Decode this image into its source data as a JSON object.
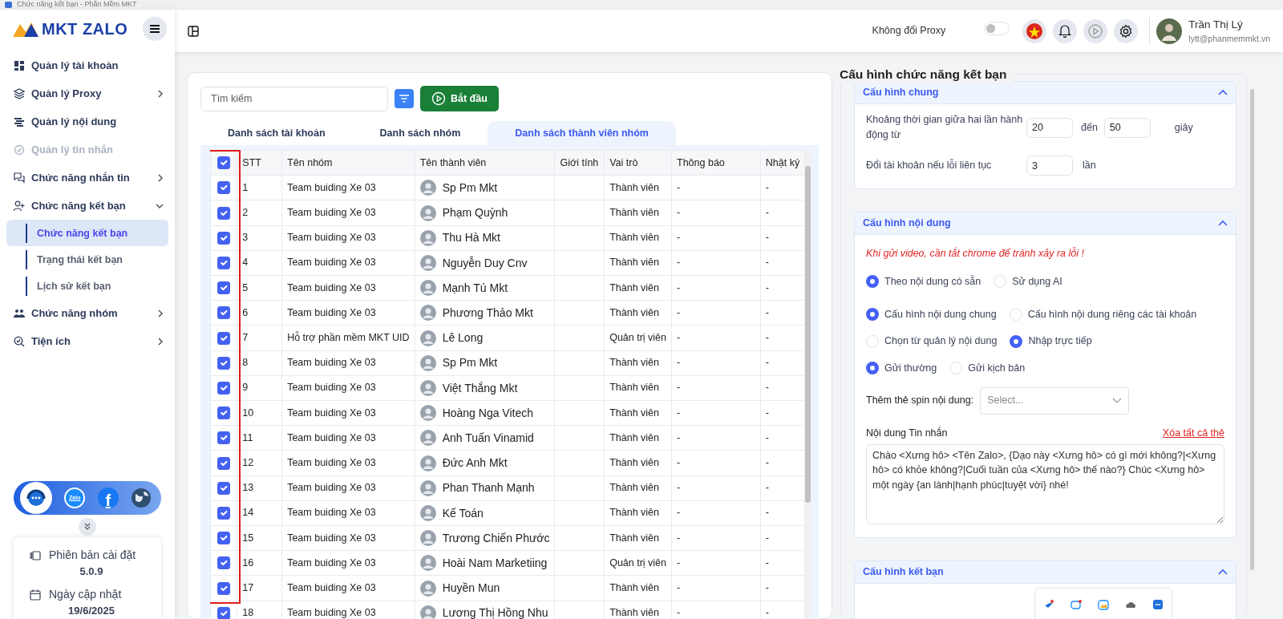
{
  "window": {
    "title": "Chức năng kết bạn - Phần Mềm MKT"
  },
  "sidebar": {
    "logo": "MKT ZALO",
    "items": [
      {
        "label": "Quản lý tài khoản",
        "chevron": false,
        "expanded": false,
        "disabled": false
      },
      {
        "label": "Quản lý Proxy",
        "chevron": true,
        "expanded": false,
        "disabled": false
      },
      {
        "label": "Quản lý nội dung",
        "chevron": false,
        "expanded": false,
        "disabled": false
      },
      {
        "label": "Quản lý tin nhắn",
        "chevron": false,
        "expanded": false,
        "disabled": true
      },
      {
        "label": "Chức năng nhắn tin",
        "chevron": true,
        "expanded": false,
        "disabled": false
      },
      {
        "label": "Chức năng kết bạn",
        "chevron": true,
        "expanded": true,
        "disabled": false,
        "children": [
          {
            "label": "Chức năng kết bạn",
            "selected": true
          },
          {
            "label": "Trạng thái kết bạn",
            "selected": false
          },
          {
            "label": "Lịch sử kết bạn",
            "selected": false
          }
        ]
      },
      {
        "label": "Chức năng nhóm",
        "chevron": true,
        "expanded": false,
        "disabled": false
      },
      {
        "label": "Tiện ích",
        "chevron": true,
        "expanded": false,
        "disabled": false
      }
    ],
    "social_links": [
      {
        "label": "Zalo"
      },
      {
        "label": "f"
      }
    ],
    "version": {
      "label": "Phiên bản cài đặt",
      "value": "5.0.9"
    },
    "updated": {
      "label": "Ngày cập nhật",
      "value": "19/6/2025"
    }
  },
  "topbar": {
    "proxy_label": "Không đổi Proxy",
    "proxy_on": false,
    "user": {
      "name": "Trần Thị Lý",
      "email": "lytt@phanmemmkt.vn"
    }
  },
  "toolbar": {
    "search": {
      "placeholder": "Tìm kiếm"
    },
    "start_button": "Bắt đầu"
  },
  "tabs": [
    {
      "label": "Danh sách tài khoản",
      "selected": false
    },
    {
      "label": "Danh sách nhóm",
      "selected": false
    },
    {
      "label": "Danh sách thành viên nhóm",
      "selected": true
    }
  ],
  "table": {
    "all_checked": true,
    "columns": [
      "STT",
      "Tên nhóm",
      "Tên thành viên",
      "Giới tính",
      "Vai trò",
      "Thông báo",
      "Nhật ký"
    ],
    "rows": [
      {
        "checked": true,
        "stt": "1",
        "group": "Team buiding Xe 03",
        "member": "Sp Pm Mkt",
        "role": "Thành viên",
        "notice": "-",
        "log": "-"
      },
      {
        "checked": true,
        "stt": "2",
        "group": "Team buiding Xe 03",
        "member": "Phạm Quỳnh",
        "role": "Thành viên",
        "notice": "-",
        "log": "-"
      },
      {
        "checked": true,
        "stt": "3",
        "group": "Team buiding Xe 03",
        "member": "Thu Hà Mkt",
        "role": "Thành viên",
        "notice": "-",
        "log": "-"
      },
      {
        "checked": true,
        "stt": "4",
        "group": "Team buiding Xe 03",
        "member": "Nguyễn Duy Cnv",
        "role": "Thành viên",
        "notice": "-",
        "log": "-"
      },
      {
        "checked": true,
        "stt": "5",
        "group": "Team buiding Xe 03",
        "member": "Mạnh Tú Mkt",
        "role": "Thành viên",
        "notice": "-",
        "log": "-"
      },
      {
        "checked": true,
        "stt": "6",
        "group": "Team buiding Xe 03",
        "member": "Phương Thảo Mkt",
        "role": "Thành viên",
        "notice": "-",
        "log": "-"
      },
      {
        "checked": true,
        "stt": "7",
        "group": "Hỗ trợ phần mềm MKT UID",
        "member": "Lê Long",
        "role": "Quản trị viên",
        "notice": "-",
        "log": "-"
      },
      {
        "checked": true,
        "stt": "8",
        "group": "Team buiding Xe 03",
        "member": "Sp Pm Mkt",
        "role": "Thành viên",
        "notice": "-",
        "log": "-"
      },
      {
        "checked": true,
        "stt": "9",
        "group": "Team buiding Xe 03",
        "member": "Việt Thắng Mkt",
        "role": "Thành viên",
        "notice": "-",
        "log": "-"
      },
      {
        "checked": true,
        "stt": "10",
        "group": "Team buiding Xe 03",
        "member": "Hoàng Nga Vitech",
        "role": "Thành viên",
        "notice": "-",
        "log": "-"
      },
      {
        "checked": true,
        "stt": "11",
        "group": "Team buiding Xe 03",
        "member": "Anh Tuấn Vinamid",
        "role": "Thành viên",
        "notice": "-",
        "log": "-"
      },
      {
        "checked": true,
        "stt": "12",
        "group": "Team buiding Xe 03",
        "member": "Đức Anh Mkt",
        "role": "Thành viên",
        "notice": "-",
        "log": "-"
      },
      {
        "checked": true,
        "stt": "13",
        "group": "Team buiding Xe 03",
        "member": "Phan Thanh Mạnh",
        "role": "Thành viên",
        "notice": "-",
        "log": "-"
      },
      {
        "checked": true,
        "stt": "14",
        "group": "Team buiding Xe 03",
        "member": "Kế Toán",
        "role": "Thành viên",
        "notice": "-",
        "log": "-"
      },
      {
        "checked": true,
        "stt": "15",
        "group": "Team buiding Xe 03",
        "member": "Trương Chiến Phước",
        "role": "Thành viên",
        "notice": "-",
        "log": "-"
      },
      {
        "checked": true,
        "stt": "16",
        "group": "Team buiding Xe 03",
        "member": "Hoài Nam Marketiing",
        "role": "Quản trị viên",
        "notice": "-",
        "log": "-"
      },
      {
        "checked": true,
        "stt": "17",
        "group": "Team buiding Xe 03",
        "member": "Huyền Mun",
        "role": "Thành viên",
        "notice": "-",
        "log": "-"
      },
      {
        "checked": true,
        "stt": "18",
        "group": "Team buiding Xe 03",
        "member": "Lương Thị Hồng Nhu",
        "role": "Thành viên",
        "notice": "-",
        "log": "-"
      }
    ]
  },
  "config": {
    "title": "Cấu hình chức năng kết bạn",
    "sections": [
      {
        "kind": "general",
        "title": "Cấu hình chung",
        "expanded": true,
        "rows": [
          {
            "label": "Khoảng thời gian giữa hai lần hành động từ",
            "values": [
              "20",
              "50"
            ],
            "between": "đến",
            "unit": "giây"
          },
          {
            "label": "Đổi tài khoản nếu lỗi liên tục",
            "values": [
              "3"
            ],
            "unit": "lần"
          }
        ]
      },
      {
        "kind": "content",
        "title": "Cấu hình nội dung",
        "expanded": true,
        "warning": "Khi gửi video, cần tắt chrome để tránh xảy ra lỗi !",
        "radio_groups": [
          [
            {
              "label": "Theo nội dung có sẵn",
              "selected": true
            },
            {
              "label": "Sử dụng AI",
              "selected": false
            }
          ],
          [
            {
              "label": "Cấu hình nội dung chung",
              "selected": true
            },
            {
              "label": "Cấu hình nội dung riêng các tài khoản",
              "selected": false
            }
          ],
          [
            {
              "label": "Chọn từ quản lý nội dung",
              "selected": false
            },
            {
              "label": "Nhập trực tiếp",
              "selected": true
            }
          ],
          [
            {
              "label": "Gửi thường",
              "selected": true
            },
            {
              "label": "Gửi kịch bản",
              "selected": false
            }
          ]
        ],
        "spin": {
          "label": "Thêm thẻ spin nội dung:",
          "placeholder": "Select..."
        },
        "message": {
          "label": "Nội dung Tin nhắn",
          "clear_link": "Xóa tất cả thẻ",
          "value": "Chào <Xưng hô> <Tên Zalo>, {Dạo này <Xưng hô> có gì mới không?|<Xưng hô> có khỏe không?|Cuối tuần của <Xưng hô> thế nào?} Chúc <Xưng hô> một ngày {an lành|hạnh phúc|tuyệt vời} nhé!"
        }
      },
      {
        "kind": "friend",
        "title": "Cấu hình kết bạn",
        "expanded": true
      }
    ]
  }
}
